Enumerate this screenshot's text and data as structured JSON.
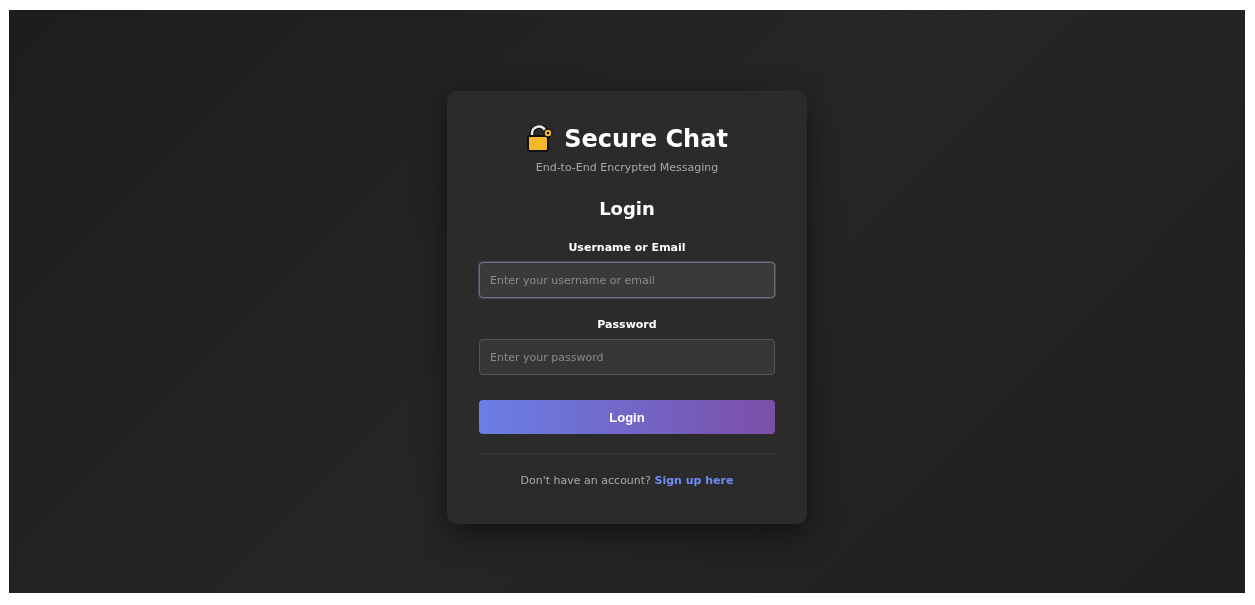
{
  "app": {
    "title": "Secure Chat",
    "subtitle": "End-to-End Encrypted Messaging"
  },
  "form": {
    "heading": "Login",
    "fields": [
      {
        "label": "Username or Email",
        "placeholder": "Enter your username or email",
        "focused": true
      },
      {
        "label": "Password",
        "placeholder": "Enter your password",
        "focused": false
      }
    ],
    "submit": "Login"
  },
  "footer": {
    "text": "Don't have an account?",
    "link": "Sign up here"
  }
}
